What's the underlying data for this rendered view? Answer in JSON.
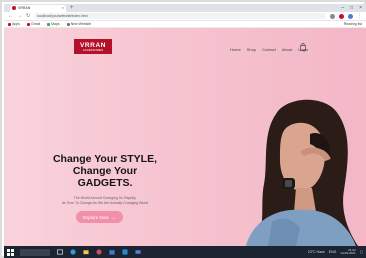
{
  "browser": {
    "tab_title": "VRRAN",
    "url": "localhost/yourwebsite/index.html",
    "bookmarks": [
      "Apps",
      "Gmail",
      "Maps",
      "New Website"
    ],
    "bookmarks_right": "Reading list"
  },
  "site": {
    "logo_main": "VRRAN",
    "logo_sub": "ACCESSORIES",
    "nav": [
      "Home",
      "Shop",
      "Contact",
      "About",
      "Login"
    ],
    "hero_line1": "Change Your STYLE,",
    "hero_line2": "Change Your GADGETS.",
    "hero_sub1": "The World Around Changing So Rapidly,",
    "hero_sub2": "Its Time To Change As We Are Actually Changing World",
    "cta_label": "Explore Now",
    "cta_arrow": "→"
  },
  "taskbar": {
    "tray_text": "23°C  Haze",
    "lang": "ENG",
    "time": "21:04",
    "date": "14-09-2021"
  },
  "colors": {
    "brand": "#b3102a",
    "cta": "#f290aa",
    "hero_bg": "#f6c4d0"
  }
}
